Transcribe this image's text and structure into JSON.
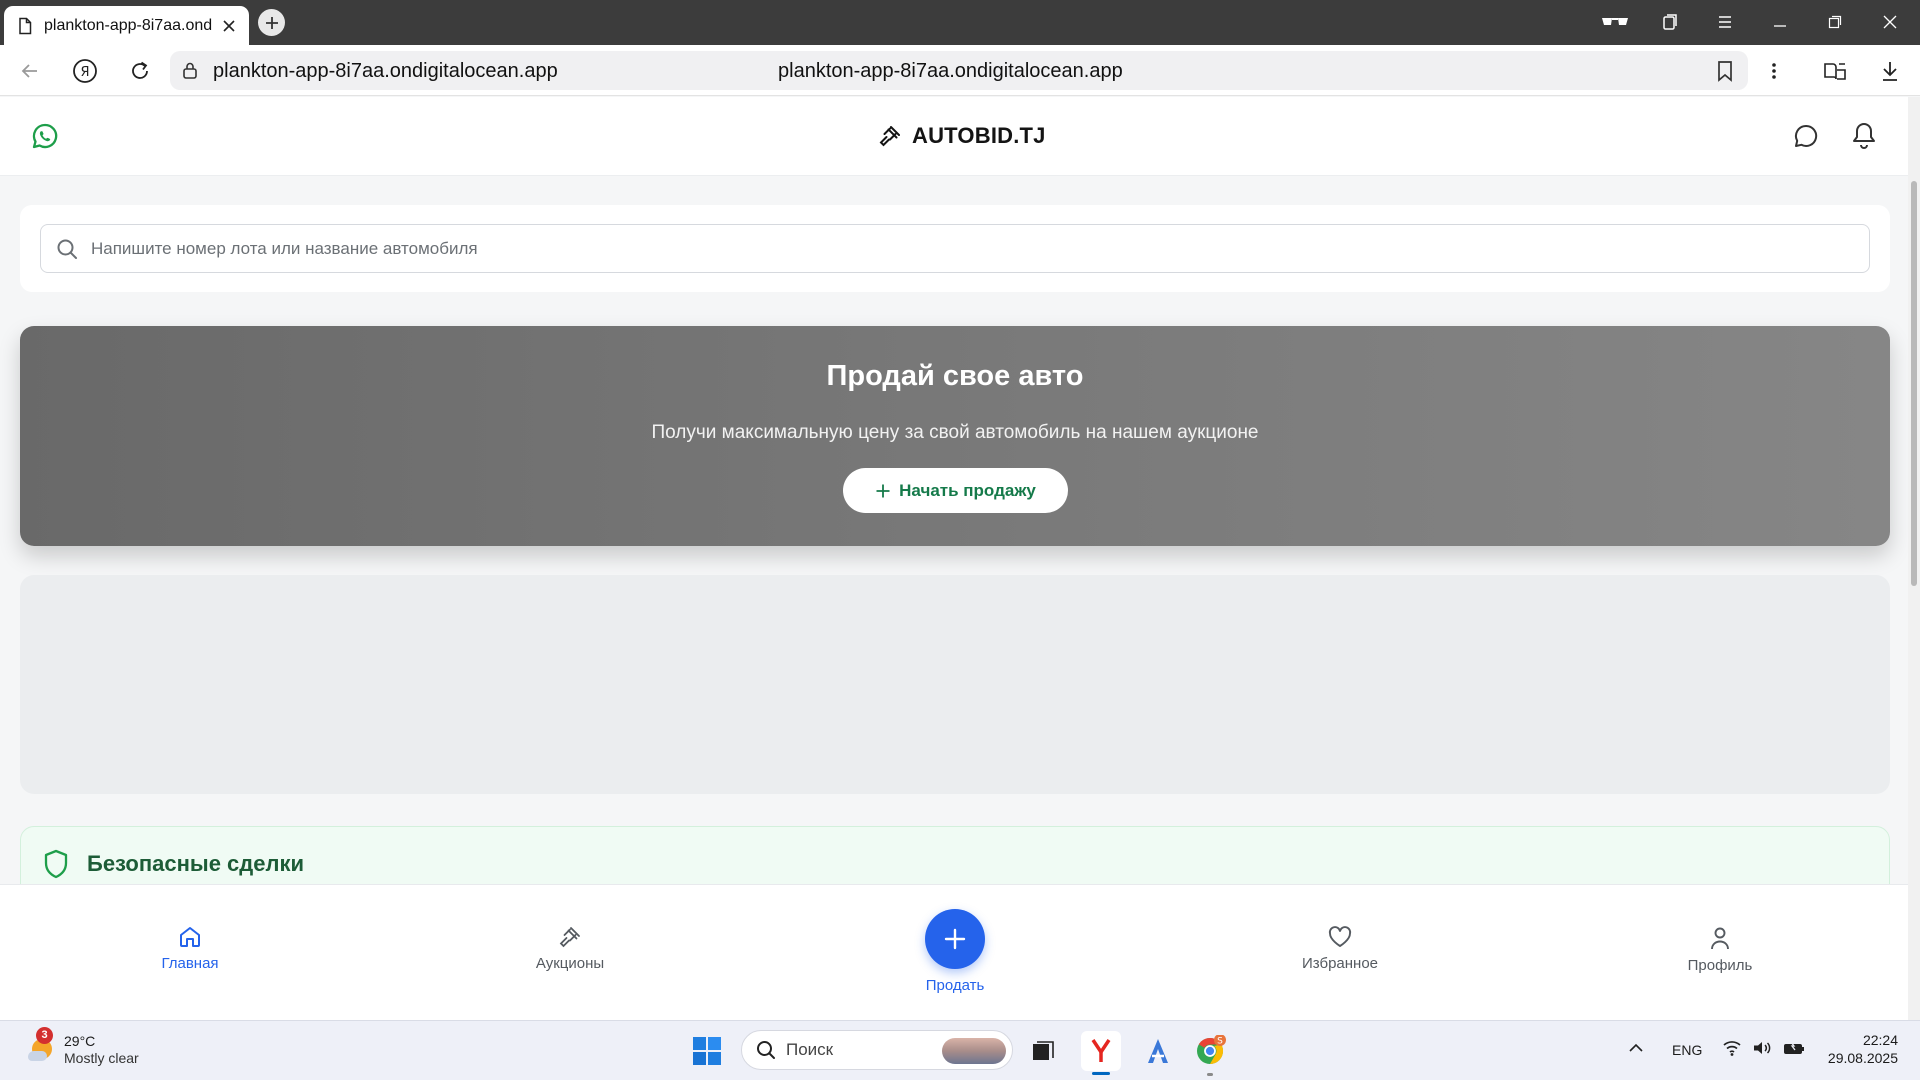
{
  "browser": {
    "tab_title": "plankton-app-8i7aa.ond",
    "url_left": "plankton-app-8i7aa.ondigitalocean.app",
    "url_center": "plankton-app-8i7aa.ondigitalocean.app"
  },
  "header": {
    "brand": "AUTOBID.TJ"
  },
  "search": {
    "placeholder": "Напишите номер лота или название автомобиля"
  },
  "hero": {
    "title": "Продай свое авто",
    "subtitle": "Получи максимальную цену за свой автомобиль на нашем аукционе",
    "button_label": "Начать продажу"
  },
  "safe_deals": {
    "title": "Безопасные сделки"
  },
  "bottom_nav": {
    "items": [
      {
        "label": "Главная",
        "icon": "home-icon",
        "active": true
      },
      {
        "label": "Аукционы",
        "icon": "gavel-icon"
      },
      {
        "label": "Продать",
        "icon": "plus-icon"
      },
      {
        "label": "Избранное",
        "icon": "heart-icon"
      },
      {
        "label": "Профиль",
        "icon": "user-icon"
      }
    ]
  },
  "taskbar": {
    "weather_badge": "3",
    "weather_temp": "29°C",
    "weather_desc": "Mostly clear",
    "search_label": "Поиск",
    "lang": "ENG",
    "time": "22:24",
    "date": "29.08.2025",
    "chrome_badge": "S"
  },
  "colors": {
    "accent": "#2563eb",
    "brand_green": "#157a4a",
    "whatsapp": "#1e9e4a",
    "hero_gray": "#767676"
  }
}
